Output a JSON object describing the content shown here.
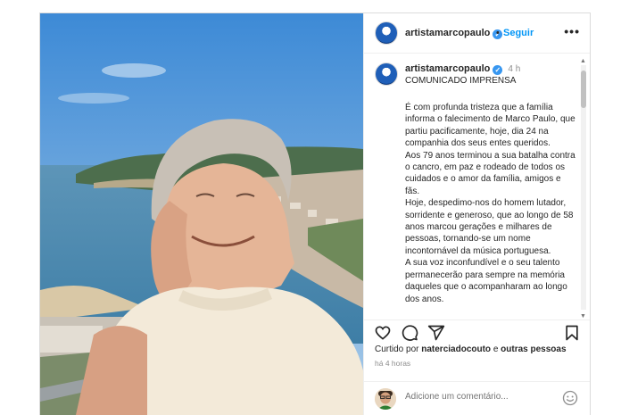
{
  "post": {
    "username": "artistamarcopaulo",
    "follow_label": "Seguir",
    "more_label": "•••",
    "caption": {
      "time": "4 h",
      "title": "COMUNICADO IMPRENSA",
      "body": "É com profunda tristeza que a família informa o falecimento de Marco Paulo, que partiu pacificamente, hoje, dia 24 na companhia dos seus entes queridos.\nAos 79 anos terminou a sua batalha contra o cancro, em paz e rodeado de todos os cuidados e o amor da família, amigos e fãs.\nHoje, despedimo-nos do homem lutador, sorridente e generoso, que ao longo de 58 anos marcou gerações e milhares de pessoas, tornando-se um nome incontornável da música portuguesa.\nA sua voz inconfundível e o seu talento permanecerão para sempre na memória daqueles que o acompanharam ao longo dos anos."
    },
    "likes": {
      "prefix": "Curtido por",
      "user": "naterciadocouto",
      "connector": "e",
      "others": "outras pessoas"
    },
    "posted_ago": "há 4 horas",
    "comment_placeholder": "Adicione um comentário...",
    "icons": [
      "heart-icon",
      "comment-icon",
      "share-icon",
      "bookmark-icon",
      "emoji-icon",
      "verified-icon",
      "more-icon"
    ],
    "colors": {
      "accent": "#0095f6",
      "verified": "#3897f0",
      "muted": "#8e8e8e",
      "text": "#262626"
    }
  }
}
